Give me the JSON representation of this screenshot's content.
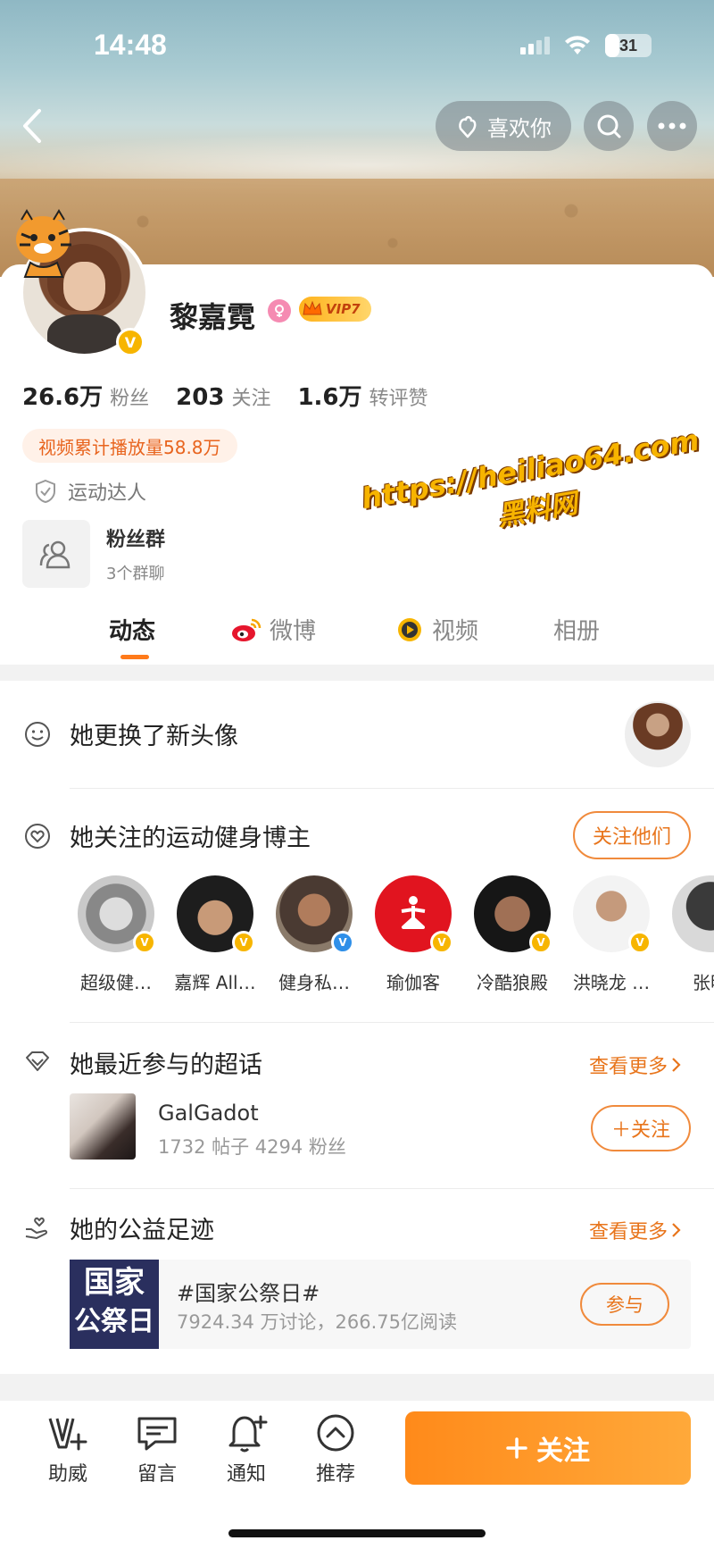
{
  "status_bar": {
    "time": "14:48",
    "battery": "31",
    "battery_level": 0.31
  },
  "nav": {
    "like_label": "喜欢你"
  },
  "profile": {
    "name": "黎嘉霓",
    "vip_label": "VIP7",
    "stats": [
      {
        "num": "26.6万",
        "label": "粉丝"
      },
      {
        "num": "203",
        "label": "关注"
      },
      {
        "num": "1.6万",
        "label": "转评赞"
      }
    ],
    "play_count": "视频累计播放量58.8万",
    "tag": "运动达人",
    "fans_group": {
      "title": "粉丝群",
      "subtitle": "3个群聊"
    }
  },
  "watermark": {
    "line1": "https://heiliao64.com",
    "line2": "黑料网"
  },
  "tabs": [
    "动态",
    "微博",
    "视频",
    "相册"
  ],
  "feed": {
    "avatar_update": "她更换了新头像",
    "fitness": {
      "title": "她关注的运动健身博主",
      "follow_button": "关注他们",
      "bloggers": [
        {
          "name": "超级健…",
          "badge_color": "#f7b500"
        },
        {
          "name": "嘉辉 All…",
          "badge_color": "#f7b500"
        },
        {
          "name": "健身私…",
          "badge_color": "#2f8fe8"
        },
        {
          "name": "瑜伽客",
          "badge_color": "#f7b500"
        },
        {
          "name": "冷酷狼殿",
          "badge_color": "#f7b500"
        },
        {
          "name": "洪晓龙 …",
          "badge_color": "#f7b500"
        },
        {
          "name": "张明",
          "badge_color": "#f7b500"
        }
      ]
    },
    "super_topic": {
      "title": "她最近参与的超话",
      "more": "查看更多",
      "name": "GalGadot",
      "stats": "1732 帖子 4294 粉丝",
      "follow": "＋关注"
    },
    "charity": {
      "title": "她的公益足迹",
      "more": "查看更多",
      "image_text_1": "国家",
      "image_text_2": "公祭日",
      "topic": "#国家公祭日#",
      "stats": "7924.34 万讨论，266.75亿阅读",
      "join": "参与"
    }
  },
  "bottom_bar": {
    "items": [
      "助威",
      "留言",
      "通知",
      "推荐"
    ],
    "follow": "关注"
  },
  "colors": {
    "accent": "#ff8a1a",
    "link": "#e8751c"
  }
}
